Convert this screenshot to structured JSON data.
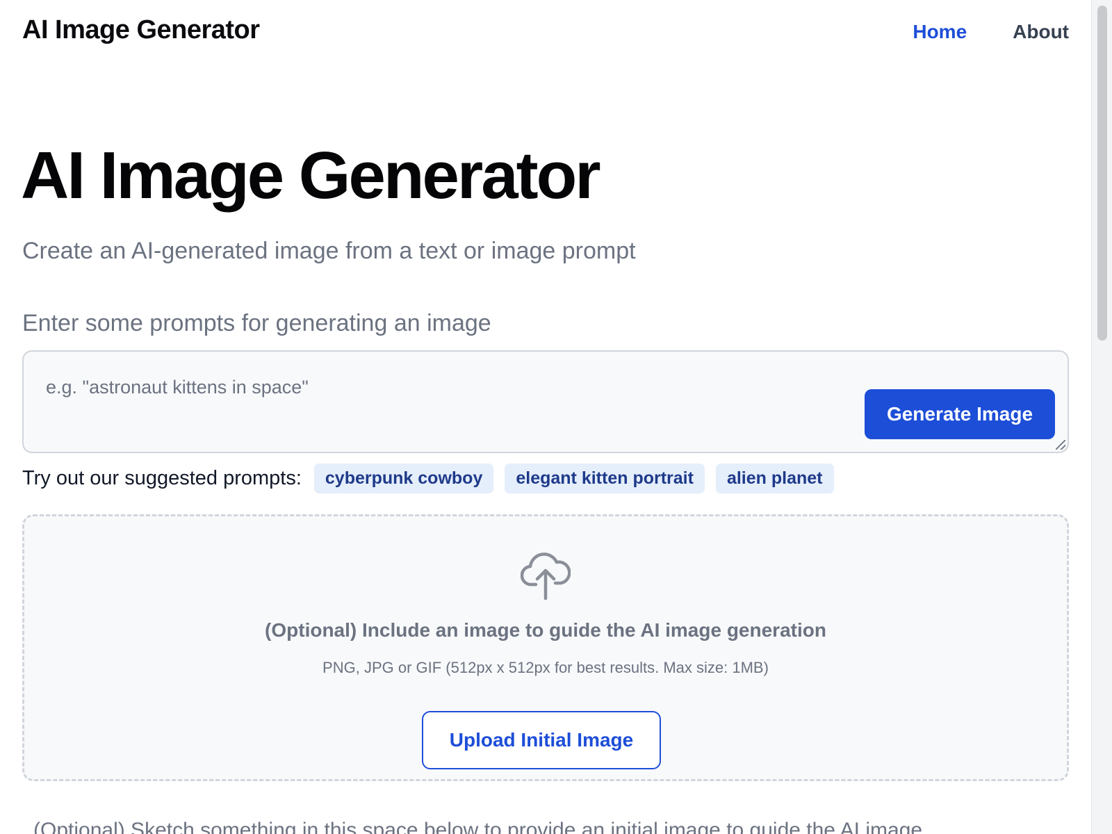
{
  "header": {
    "title": "AI Image Generator",
    "nav": [
      {
        "label": "Home",
        "active": true
      },
      {
        "label": "About",
        "active": false
      }
    ]
  },
  "hero": {
    "title": "AI Image Generator",
    "subtitle": "Create an AI-generated image from a text or image prompt"
  },
  "prompt": {
    "label": "Enter some prompts for generating an image",
    "placeholder": "e.g. \"astronaut kittens in space\"",
    "value": "",
    "generate_label": "Generate Image"
  },
  "suggestions": {
    "label": "Try out our suggested prompts:",
    "items": [
      "cyberpunk cowboy",
      "elegant kitten portrait",
      "alien planet"
    ]
  },
  "upload": {
    "icon": "cloud-upload-icon",
    "title": "(Optional) Include an image to guide the AI image generation",
    "hint": "PNG, JPG or GIF (512px x 512px for best results. Max size: 1MB)",
    "button_label": "Upload Initial Image"
  },
  "sketch": {
    "text": "(Optional) Sketch something in this space below to provide an initial image to guide the AI image"
  },
  "colors": {
    "accent": "#1d4ed8",
    "chip_bg": "#e5eefb",
    "chip_text": "#1e3a8a",
    "muted_text": "#6b7280"
  }
}
